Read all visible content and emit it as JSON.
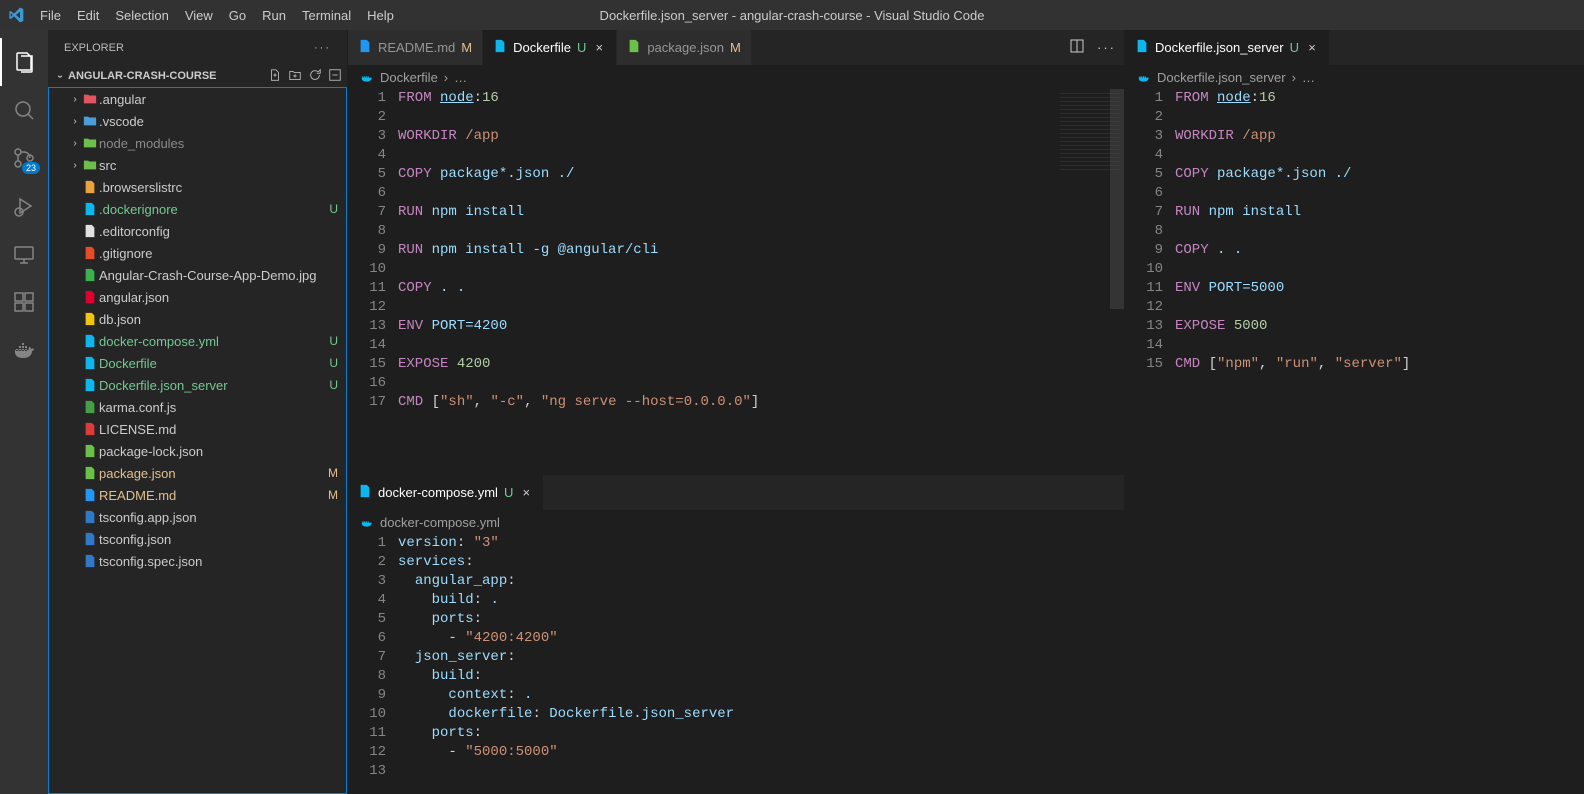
{
  "window": {
    "title": "Dockerfile.json_server - angular-crash-course - Visual Studio Code"
  },
  "menu": [
    "File",
    "Edit",
    "Selection",
    "View",
    "Go",
    "Run",
    "Terminal",
    "Help"
  ],
  "explorer": {
    "title": "EXPLORER",
    "root": "ANGULAR-CRASH-COURSE"
  },
  "scm_badge": "23",
  "tree": [
    {
      "name": ".angular",
      "kind": "folder",
      "indent": 1,
      "chev": true,
      "cls": "",
      "status": "",
      "color": "#e05561"
    },
    {
      "name": ".vscode",
      "kind": "folder",
      "indent": 1,
      "chev": true,
      "cls": "",
      "status": "",
      "color": "#4b9ed9"
    },
    {
      "name": "node_modules",
      "kind": "folder",
      "indent": 1,
      "chev": true,
      "cls": "muted",
      "status": "",
      "color": "#6cc04a"
    },
    {
      "name": "src",
      "kind": "folder",
      "indent": 1,
      "chev": true,
      "cls": "",
      "status": "",
      "color": "#6cc04a"
    },
    {
      "name": ".browserslistrc",
      "kind": "file",
      "indent": 1,
      "chev": false,
      "cls": "",
      "status": "",
      "color": "#e8a33d"
    },
    {
      "name": ".dockerignore",
      "kind": "file",
      "indent": 1,
      "chev": false,
      "cls": "untracked",
      "status": "U",
      "color": "#0db7ed"
    },
    {
      "name": ".editorconfig",
      "kind": "file",
      "indent": 1,
      "chev": false,
      "cls": "",
      "status": "",
      "color": "#e1e1e1"
    },
    {
      "name": ".gitignore",
      "kind": "file",
      "indent": 1,
      "chev": false,
      "cls": "",
      "status": "",
      "color": "#e44d26"
    },
    {
      "name": "Angular-Crash-Course-App-Demo.jpg",
      "kind": "file",
      "indent": 1,
      "chev": false,
      "cls": "",
      "status": "",
      "color": "#3ab14a"
    },
    {
      "name": "angular.json",
      "kind": "file",
      "indent": 1,
      "chev": false,
      "cls": "",
      "status": "",
      "color": "#dd0031"
    },
    {
      "name": "db.json",
      "kind": "file",
      "indent": 1,
      "chev": false,
      "cls": "",
      "status": "",
      "color": "#f1c40f"
    },
    {
      "name": "docker-compose.yml",
      "kind": "file",
      "indent": 1,
      "chev": false,
      "cls": "untracked",
      "status": "U",
      "color": "#0db7ed"
    },
    {
      "name": "Dockerfile",
      "kind": "file",
      "indent": 1,
      "chev": false,
      "cls": "untracked",
      "status": "U",
      "color": "#0db7ed"
    },
    {
      "name": "Dockerfile.json_server",
      "kind": "file",
      "indent": 1,
      "chev": false,
      "cls": "untracked",
      "status": "U",
      "color": "#0db7ed"
    },
    {
      "name": "karma.conf.js",
      "kind": "file",
      "indent": 1,
      "chev": false,
      "cls": "",
      "status": "",
      "color": "#43a047"
    },
    {
      "name": "LICENSE.md",
      "kind": "file",
      "indent": 1,
      "chev": false,
      "cls": "",
      "status": "",
      "color": "#dd3b3b"
    },
    {
      "name": "package-lock.json",
      "kind": "file",
      "indent": 1,
      "chev": false,
      "cls": "",
      "status": "",
      "color": "#6cc04a"
    },
    {
      "name": "package.json",
      "kind": "file",
      "indent": 1,
      "chev": false,
      "cls": "modified",
      "status": "M",
      "color": "#6cc04a"
    },
    {
      "name": "README.md",
      "kind": "file",
      "indent": 1,
      "chev": false,
      "cls": "modified",
      "status": "M",
      "color": "#2196f3"
    },
    {
      "name": "tsconfig.app.json",
      "kind": "file",
      "indent": 1,
      "chev": false,
      "cls": "",
      "status": "",
      "color": "#3178c6"
    },
    {
      "name": "tsconfig.json",
      "kind": "file",
      "indent": 1,
      "chev": false,
      "cls": "",
      "status": "",
      "color": "#3178c6"
    },
    {
      "name": "tsconfig.spec.json",
      "kind": "file",
      "indent": 1,
      "chev": false,
      "cls": "",
      "status": "",
      "color": "#3178c6"
    }
  ],
  "tabs_left": [
    {
      "label": "README.md",
      "suffix": "M",
      "suffixCls": "mod",
      "active": false,
      "color": "#2196f3"
    },
    {
      "label": "Dockerfile",
      "suffix": "U",
      "suffixCls": "unt",
      "active": true,
      "color": "#0db7ed",
      "closable": true
    },
    {
      "label": "package.json",
      "suffix": "M",
      "suffixCls": "mod",
      "active": false,
      "color": "#6cc04a"
    }
  ],
  "tabs_right": [
    {
      "label": "Dockerfile.json_server",
      "suffix": "U",
      "suffixCls": "unt",
      "active": true,
      "color": "#0db7ed",
      "closable": true
    }
  ],
  "tabs_bottom": [
    {
      "label": "docker-compose.yml",
      "suffix": "U",
      "suffixCls": "unt",
      "active": true,
      "color": "#0db7ed",
      "closable": true
    }
  ],
  "breadcrumb_left": {
    "icon": "docker",
    "name": "Dockerfile",
    "rest": "…"
  },
  "breadcrumb_right": {
    "icon": "docker",
    "name": "Dockerfile.json_server",
    "rest": "…"
  },
  "breadcrumb_bottom": {
    "icon": "docker",
    "name": "docker-compose.yml"
  },
  "editor_left": {
    "lines": 17,
    "html": "<span class='kw'>FROM</span> <span class='id underline'>node</span><span class='punct'>:</span><span class='num'>16</span>\n\n<span class='kw'>WORKDIR</span> <span class='path'>/app</span>\n\n<span class='kw'>COPY</span> <span class='id'>package*.json ./</span>\n\n<span class='kw'>RUN</span> <span class='id'>npm install</span>\n\n<span class='kw'>RUN</span> <span class='id'>npm install -g @angular/cli</span>\n\n<span class='kw'>COPY</span> <span class='id'>. .</span>\n\n<span class='kw'>ENV</span> <span class='id'>PORT=4200</span>\n\n<span class='kw'>EXPOSE</span> <span class='num'>4200</span>\n\n<span class='kw'>CMD</span> <span class='punct'>[</span><span class='str'>\"sh\"</span><span class='punct'>, </span><span class='str'>\"-c\"</span><span class='punct'>, </span><span class='str'>\"ng serve --host=0.0.0.0\"</span><span class='punct'>]</span>"
  },
  "editor_right": {
    "lines": 15,
    "html": "<span class='kw'>FROM</span> <span class='id underline'>node</span><span class='punct'>:</span><span class='num'>16</span>\n\n<span class='kw'>WORKDIR</span> <span class='path'>/app</span>\n\n<span class='kw'>COPY</span> <span class='id'>package*.json ./</span>\n\n<span class='kw'>RUN</span> <span class='id'>npm install</span>\n\n<span class='kw'>COPY</span> <span class='id'>. .</span>\n\n<span class='kw'>ENV</span> <span class='id'>PORT=5000</span>\n\n<span class='kw'>EXPOSE</span> <span class='num'>5000</span>\n\n<span class='kw'>CMD</span> <span class='punct'>[</span><span class='str'>\"npm\"</span><span class='punct'>, </span><span class='str'>\"run\"</span><span class='punct'>, </span><span class='str'>\"server\"</span><span class='punct'>]</span>"
  },
  "editor_bottom": {
    "lines": 13,
    "html": "<span class='id'>version</span><span class='punct'>: </span><span class='str'>\"3\"</span>\n<span class='id'>services</span><span class='punct'>:</span>\n  <span class='id'>angular_app</span><span class='punct'>:</span>\n    <span class='id'>build</span><span class='punct'>: </span><span class='id'>.</span>\n    <span class='id'>ports</span><span class='punct'>:</span>\n      - <span class='str'>\"4200:4200\"</span>\n  <span class='id'>json_server</span><span class='punct'>:</span>\n    <span class='id'>build</span><span class='punct'>:</span>\n      <span class='id'>context</span><span class='punct'>: </span><span class='id'>.</span>\n      <span class='id'>dockerfile</span><span class='punct'>: </span><span class='id'>Dockerfile.json_server</span>\n    <span class='id'>ports</span><span class='punct'>:</span>\n      - <span class='str'>\"5000:5000\"</span>\n"
  }
}
